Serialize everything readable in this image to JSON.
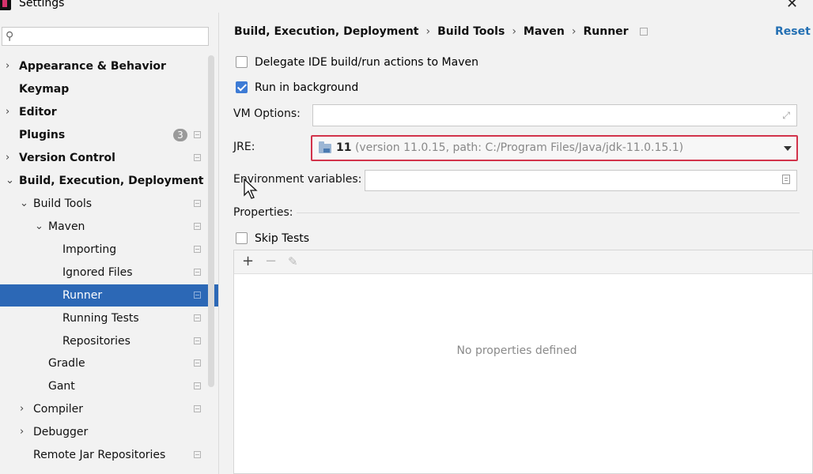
{
  "window": {
    "title": "Settings"
  },
  "search": {
    "placeholder": ""
  },
  "sidebar": {
    "items": [
      {
        "label": "Appearance & Behavior"
      },
      {
        "label": "Keymap"
      },
      {
        "label": "Editor"
      },
      {
        "label": "Plugins",
        "badge": "3"
      },
      {
        "label": "Version Control"
      },
      {
        "label": "Build, Execution, Deployment"
      },
      {
        "label": "Build Tools"
      },
      {
        "label": "Maven"
      },
      {
        "label": "Importing"
      },
      {
        "label": "Ignored Files"
      },
      {
        "label": "Runner",
        "selected": true
      },
      {
        "label": "Running Tests"
      },
      {
        "label": "Repositories"
      },
      {
        "label": "Gradle"
      },
      {
        "label": "Gant"
      },
      {
        "label": "Compiler"
      },
      {
        "label": "Debugger"
      },
      {
        "label": "Remote Jar Repositories"
      }
    ]
  },
  "breadcrumb": [
    "Build, Execution, Deployment",
    "Build Tools",
    "Maven",
    "Runner"
  ],
  "reset_label": "Reset",
  "form": {
    "delegate_label": "Delegate IDE build/run actions to Maven",
    "delegate_checked": false,
    "background_label": "Run in background",
    "background_checked": true,
    "vm_label": "VM Options:",
    "vm_value": "",
    "jre_label": "JRE:",
    "jre_version": "11",
    "jre_detail": "(version 11.0.15, path: C:/Program Files/Java/jdk-11.0.15.1)",
    "env_label": "Environment variables:",
    "env_value": "",
    "properties_label": "Properties:",
    "skip_tests_label": "Skip Tests",
    "skip_tests_checked": false
  },
  "properties": {
    "toolbar": {
      "add": "+",
      "remove": "−",
      "edit": "✎"
    },
    "empty_text": "No properties defined"
  },
  "colors": {
    "selection": "#2c68b6",
    "link": "#2470b3",
    "error_border": "#d2334b",
    "checkbox_checked": "#3d7bd5"
  }
}
